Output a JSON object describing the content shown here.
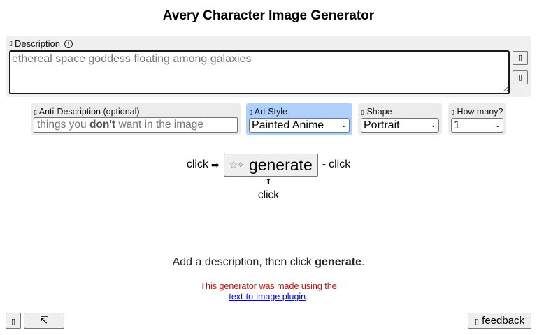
{
  "title": "Avery Character Image Generator",
  "description": {
    "label": "Description",
    "label_icon": "edit-icon",
    "info_icon": "info-icon",
    "placeholder": "ethereal space goddess floating among galaxies",
    "side_buttons": [
      "shuffle-icon",
      "list-icon"
    ]
  },
  "anti_description": {
    "label": "Anti-Description (optional)",
    "placeholder_before": "things you ",
    "placeholder_bold": "don't",
    "placeholder_after": " want in the image"
  },
  "art_style": {
    "label": "Art Style",
    "selected": "Painted Anime",
    "highlight_color": "#aed0fb"
  },
  "shape": {
    "label": "Shape",
    "selected": "Portrait"
  },
  "how_many": {
    "label": "How many?",
    "selected": "1"
  },
  "generate": {
    "left_text": "click",
    "left_arrow": "➡",
    "button_icon": "✨",
    "button_label": "generate",
    "right_arrow": "⬅",
    "right_text": "click",
    "up_arrow": "⬆",
    "below_text": "click"
  },
  "hint": {
    "before": "Add a description, then click ",
    "bold": "generate",
    "after": "."
  },
  "plugin_note": {
    "line1": "This generator was made using the",
    "link": "text-to-image plugin",
    "after": "."
  },
  "bottom": {
    "feedback_label": "feedback",
    "feedback_icon": "chat-icon",
    "left_icon_button": "settings-icon",
    "expand_icon": "↸"
  }
}
